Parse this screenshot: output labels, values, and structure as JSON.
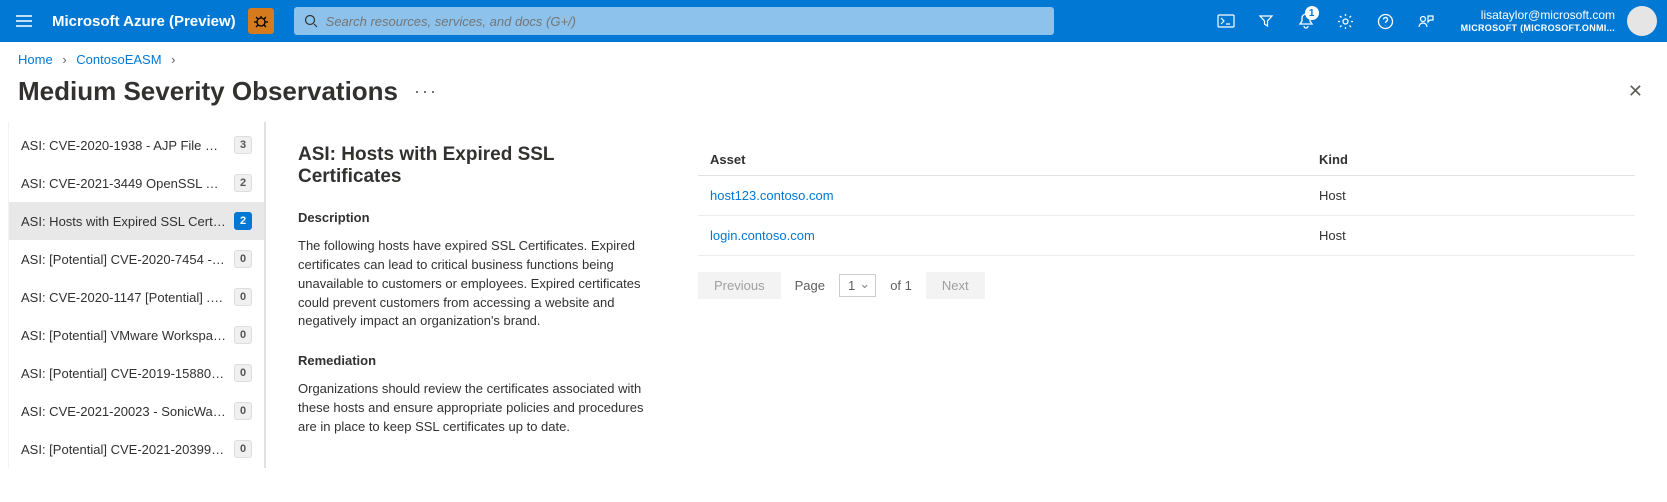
{
  "header": {
    "brand": "Microsoft Azure (Preview)",
    "search_placeholder": "Search resources, services, and docs (G+/)",
    "notification_count": "1",
    "account_email": "lisataylor@microsoft.com",
    "account_directory": "MICROSOFT (MICROSOFT.ONMI..."
  },
  "breadcrumb": {
    "home": "Home",
    "workspace": "ContosoEASM"
  },
  "page": {
    "title": "Medium Severity Observations"
  },
  "sidelist": [
    {
      "label": "ASI: CVE-2020-1938 - AJP File Re...",
      "count": "3",
      "selected": false
    },
    {
      "label": "ASI: CVE-2021-3449 OpenSSL De...",
      "count": "2",
      "selected": false
    },
    {
      "label": "ASI: Hosts with Expired SSL Certifi...",
      "count": "2",
      "selected": true
    },
    {
      "label": "ASI: [Potential] CVE-2020-7454 - ...",
      "count": "0",
      "selected": false
    },
    {
      "label": "ASI: CVE-2020-1147 [Potential] .N...",
      "count": "0",
      "selected": false
    },
    {
      "label": "ASI: [Potential] VMware Workspac...",
      "count": "0",
      "selected": false
    },
    {
      "label": "ASI: [Potential] CVE-2019-15880 -...",
      "count": "0",
      "selected": false
    },
    {
      "label": "ASI: CVE-2021-20023 - SonicWall ...",
      "count": "0",
      "selected": false
    },
    {
      "label": "ASI: [Potential] CVE-2021-20399 -...",
      "count": "0",
      "selected": false
    }
  ],
  "detail": {
    "title": "ASI: Hosts with Expired SSL Certificates",
    "description_heading": "Description",
    "description_text": "The following hosts have expired SSL Certificates. Expired certificates can lead to critical business functions being unavailable to customers or employees. Expired certificates could prevent customers from accessing a website and negatively impact an organization's brand.",
    "remediation_heading": "Remediation",
    "remediation_text": "Organizations should review the certificates associated with these hosts and ensure appropriate policies and procedures are in place to keep SSL certificates up to date."
  },
  "table": {
    "col_asset": "Asset",
    "col_kind": "Kind",
    "rows": [
      {
        "asset": "host123.contoso.com",
        "kind": "Host"
      },
      {
        "asset": "login.contoso.com",
        "kind": "Host"
      }
    ]
  },
  "pager": {
    "prev": "Previous",
    "next": "Next",
    "page_label": "Page",
    "page_current": "1",
    "of_label": "of",
    "page_total": "1"
  }
}
